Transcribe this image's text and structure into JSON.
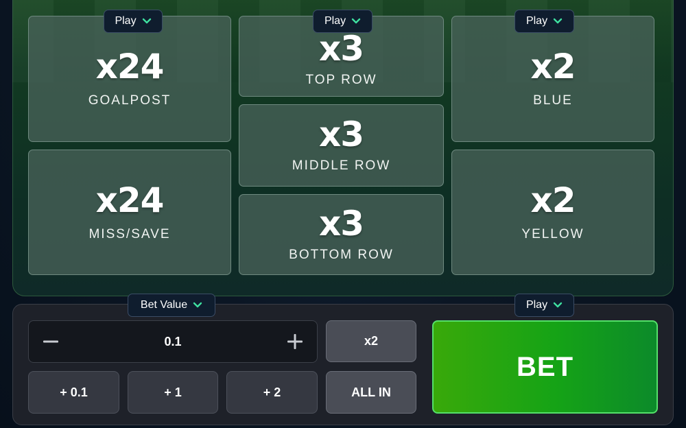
{
  "tiles": [
    {
      "mult": "x24",
      "label": "GOALPOST"
    },
    {
      "mult": "x24",
      "label": "MISS/SAVE"
    },
    {
      "mult": "x3",
      "label": "TOP ROW"
    },
    {
      "mult": "x3",
      "label": "MIDDLE ROW"
    },
    {
      "mult": "x3",
      "label": "BOTTOM ROW"
    },
    {
      "mult": "x2",
      "label": "BLUE"
    },
    {
      "mult": "x2",
      "label": "YELLOW"
    }
  ],
  "play_label": "Play",
  "bet_value_label": "Bet Value",
  "stepper": {
    "value": "0.1",
    "minus_icon": "minus-icon",
    "plus_icon": "plus-icon"
  },
  "quick_add": [
    "+ 0.1",
    "+ 1",
    "+ 2"
  ],
  "double_label": "x2",
  "all_in_label": "ALL IN",
  "bet_label": "BET",
  "colors": {
    "accent_green": "#15a316",
    "chevron": "#3fe0a0",
    "panel": "#1e2129"
  }
}
